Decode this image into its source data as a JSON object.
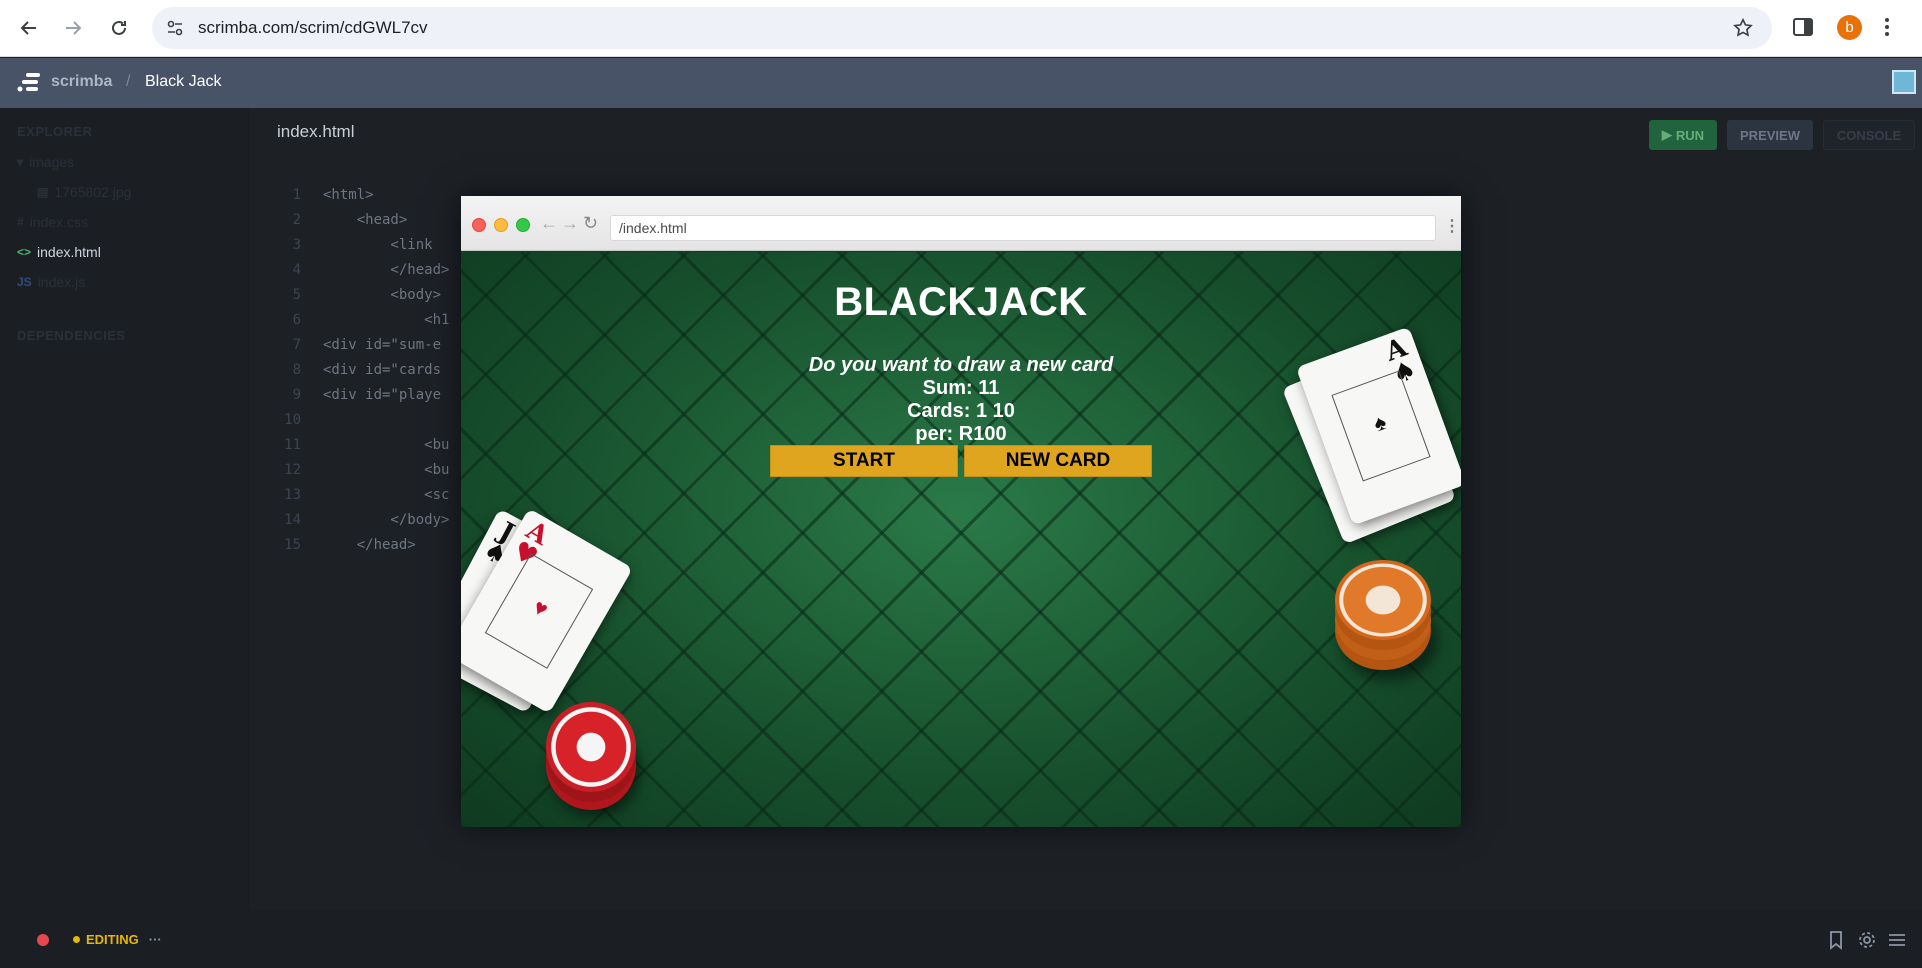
{
  "browser": {
    "url": "scrimba.com/scrim/cdGWL7cv",
    "profile_initial": "b"
  },
  "scrimba": {
    "brand": "scrimba",
    "separator": "/",
    "title": "Black Jack"
  },
  "sidebar": {
    "explorer_heading": "EXPLORER",
    "folder": "images",
    "items": [
      {
        "icon": "▤",
        "label": "1765802.jpg"
      },
      {
        "icon": "#",
        "label": "index.css"
      },
      {
        "icon": "<>",
        "label": "index.html"
      },
      {
        "icon": "JS",
        "label": "index.js"
      }
    ],
    "dependencies_heading": "DEPENDENCIES"
  },
  "editor": {
    "file_name": "index.html",
    "run_label": "RUN",
    "preview_label": "PREVIEW",
    "console_label": "CONSOLE",
    "lines": [
      {
        "n": "1",
        "code": "<html>"
      },
      {
        "n": "2",
        "code": "    <head>"
      },
      {
        "n": "3",
        "code": "        <link"
      },
      {
        "n": "4",
        "code": "        </head>"
      },
      {
        "n": "5",
        "code": "        <body>"
      },
      {
        "n": "6",
        "code": "            <h1"
      },
      {
        "n": "7",
        "code": "<div id=\"sum-e"
      },
      {
        "n": "8",
        "code": "<div id=\"cards"
      },
      {
        "n": "9",
        "code": "<div id=\"playe"
      },
      {
        "n": "10",
        "code": ""
      },
      {
        "n": "11",
        "code": "            <bu"
      },
      {
        "n": "12",
        "code": "            <bu"
      },
      {
        "n": "13",
        "code": "            <sc"
      },
      {
        "n": "14",
        "code": "        </body>"
      },
      {
        "n": "15",
        "code": "    </head>"
      }
    ]
  },
  "preview": {
    "url": "/index.html",
    "title": "BLACKJACK",
    "message": "Do you want to draw a new card",
    "sum": "Sum: 11",
    "cards": "Cards: 1 10",
    "player": "per: R100",
    "start_label": "START",
    "new_card_label": "NEW CARD"
  },
  "bottom_bar": {
    "status": "EDITING",
    "more": "···"
  },
  "colors": {
    "header": "#485367",
    "run_green": "#21633d",
    "button_gold": "#dfa51f",
    "table_green": "#1c5a34",
    "editing_yellow": "#e6b800",
    "record_red": "#e5484d"
  }
}
